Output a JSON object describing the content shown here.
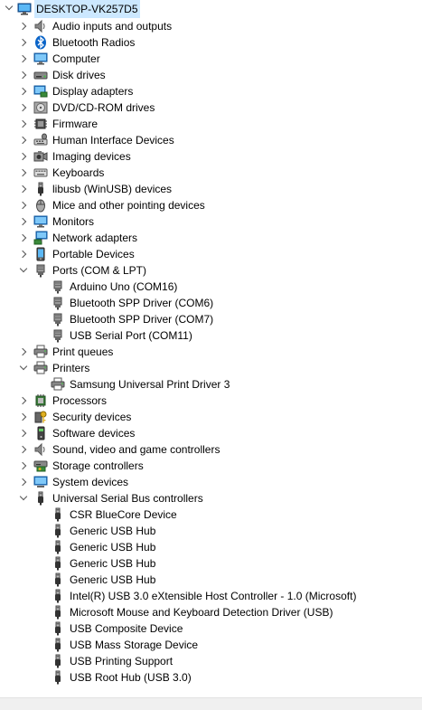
{
  "root": {
    "label": "DESKTOP-VK257D5",
    "icon": "computer-icon",
    "expanded": true
  },
  "categories": [
    {
      "id": "audio",
      "label": "Audio inputs and outputs",
      "icon": "audio-icon",
      "expanded": false,
      "children": []
    },
    {
      "id": "bluetooth",
      "label": "Bluetooth Radios",
      "icon": "bluetooth-icon",
      "expanded": false,
      "children": []
    },
    {
      "id": "computer",
      "label": "Computer",
      "icon": "monitor-icon",
      "expanded": false,
      "children": []
    },
    {
      "id": "disk",
      "label": "Disk drives",
      "icon": "disk-icon",
      "expanded": false,
      "children": []
    },
    {
      "id": "display",
      "label": "Display adapters",
      "icon": "display-adapter-icon",
      "expanded": false,
      "children": []
    },
    {
      "id": "dvd",
      "label": "DVD/CD-ROM drives",
      "icon": "dvd-icon",
      "expanded": false,
      "children": []
    },
    {
      "id": "firmware",
      "label": "Firmware",
      "icon": "firmware-icon",
      "expanded": false,
      "children": []
    },
    {
      "id": "hid",
      "label": "Human Interface Devices",
      "icon": "hid-icon",
      "expanded": false,
      "children": []
    },
    {
      "id": "imaging",
      "label": "Imaging devices",
      "icon": "camera-icon",
      "expanded": false,
      "children": []
    },
    {
      "id": "keyboards",
      "label": "Keyboards",
      "icon": "keyboard-icon",
      "expanded": false,
      "children": []
    },
    {
      "id": "libusb",
      "label": "libusb (WinUSB) devices",
      "icon": "usb-plug-icon",
      "expanded": false,
      "children": []
    },
    {
      "id": "mice",
      "label": "Mice and other pointing devices",
      "icon": "mouse-icon",
      "expanded": false,
      "children": []
    },
    {
      "id": "monitors",
      "label": "Monitors",
      "icon": "monitor-icon",
      "expanded": false,
      "children": []
    },
    {
      "id": "network",
      "label": "Network adapters",
      "icon": "network-icon",
      "expanded": false,
      "children": []
    },
    {
      "id": "portable",
      "label": "Portable Devices",
      "icon": "portable-device-icon",
      "expanded": false,
      "children": []
    },
    {
      "id": "ports",
      "label": "Ports (COM & LPT)",
      "icon": "port-icon",
      "expanded": true,
      "children": [
        {
          "label": "Arduino Uno (COM16)",
          "icon": "port-icon"
        },
        {
          "label": "Bluetooth SPP Driver (COM6)",
          "icon": "port-icon"
        },
        {
          "label": "Bluetooth SPP Driver (COM7)",
          "icon": "port-icon"
        },
        {
          "label": "USB Serial Port (COM11)",
          "icon": "port-icon"
        }
      ]
    },
    {
      "id": "printqueues",
      "label": "Print queues",
      "icon": "printer-icon",
      "expanded": false,
      "children": []
    },
    {
      "id": "printers",
      "label": "Printers",
      "icon": "printer-icon",
      "expanded": true,
      "children": [
        {
          "label": "Samsung Universal Print Driver 3",
          "icon": "printer-icon"
        }
      ]
    },
    {
      "id": "processors",
      "label": "Processors",
      "icon": "processor-icon",
      "expanded": false,
      "children": []
    },
    {
      "id": "security",
      "label": "Security devices",
      "icon": "security-key-icon",
      "expanded": false,
      "children": []
    },
    {
      "id": "software",
      "label": "Software devices",
      "icon": "software-device-icon",
      "expanded": false,
      "children": []
    },
    {
      "id": "sound",
      "label": "Sound, video and game controllers",
      "icon": "speaker-icon",
      "expanded": false,
      "children": []
    },
    {
      "id": "storage",
      "label": "Storage controllers",
      "icon": "storage-controller-icon",
      "expanded": false,
      "children": []
    },
    {
      "id": "system",
      "label": "System devices",
      "icon": "system-device-icon",
      "expanded": false,
      "children": []
    },
    {
      "id": "usb",
      "label": "Universal Serial Bus controllers",
      "icon": "usb-plug-icon",
      "expanded": true,
      "children": [
        {
          "label": "CSR BlueCore Device",
          "icon": "usb-plug-icon"
        },
        {
          "label": "Generic USB Hub",
          "icon": "usb-plug-icon"
        },
        {
          "label": "Generic USB Hub",
          "icon": "usb-plug-icon"
        },
        {
          "label": "Generic USB Hub",
          "icon": "usb-plug-icon"
        },
        {
          "label": "Generic USB Hub",
          "icon": "usb-plug-icon"
        },
        {
          "label": "Intel(R) USB 3.0 eXtensible Host Controller - 1.0 (Microsoft)",
          "icon": "usb-plug-icon"
        },
        {
          "label": "Microsoft Mouse and Keyboard Detection Driver (USB)",
          "icon": "usb-plug-icon"
        },
        {
          "label": "USB Composite Device",
          "icon": "usb-plug-icon"
        },
        {
          "label": "USB Mass Storage Device",
          "icon": "usb-plug-icon"
        },
        {
          "label": "USB Printing Support",
          "icon": "usb-plug-icon"
        },
        {
          "label": "USB Root Hub (USB 3.0)",
          "icon": "usb-plug-icon"
        }
      ]
    }
  ],
  "colors": {
    "selection": "#cce8ff",
    "chevron": "#555555",
    "scrollbar": "#f0f0f0"
  }
}
